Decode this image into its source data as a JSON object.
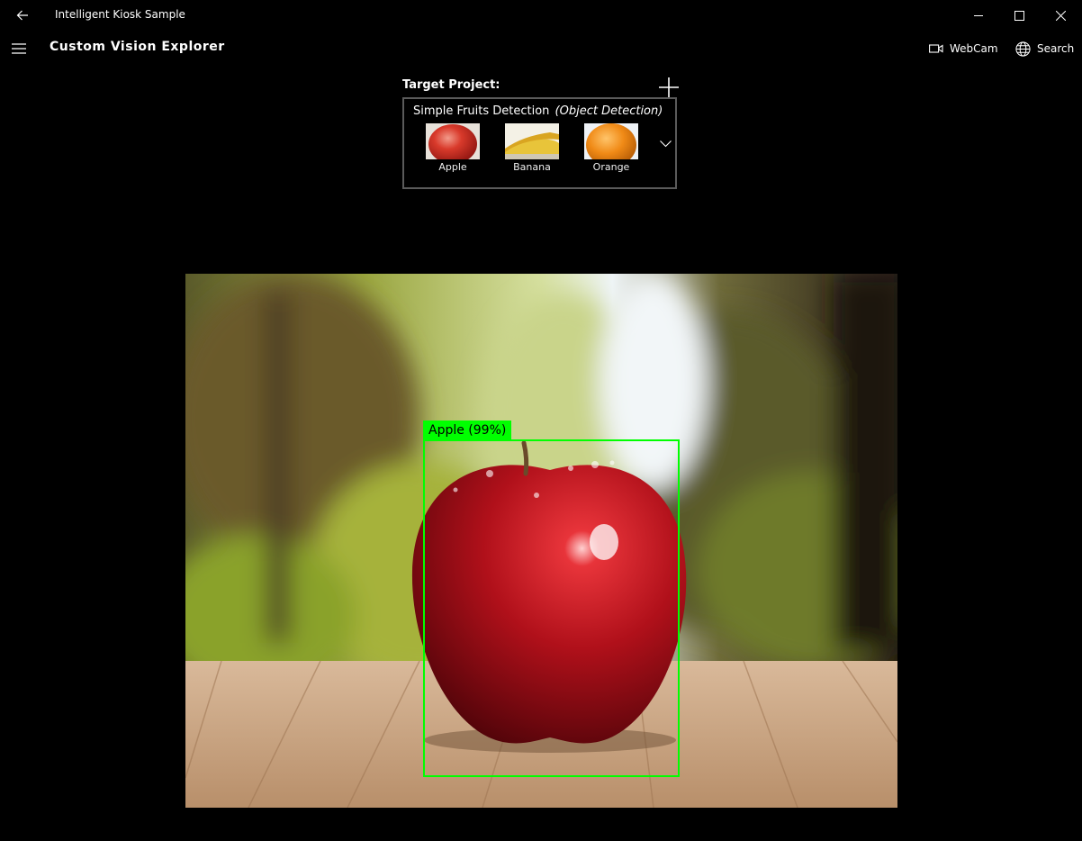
{
  "window": {
    "title": "Intelligent Kiosk Sample"
  },
  "header": {
    "title": "Custom Vision Explorer",
    "webcam_label": "WebCam",
    "search_label": "Search"
  },
  "project": {
    "target_label": "Target Project:",
    "name": "Simple Fruits Detection",
    "type": "(Object Detection)",
    "tags": [
      {
        "label": "Apple"
      },
      {
        "label": "Banana"
      },
      {
        "label": "Orange"
      }
    ]
  },
  "detection": {
    "label": "Apple (99%)",
    "box_color": "#00ff00"
  }
}
